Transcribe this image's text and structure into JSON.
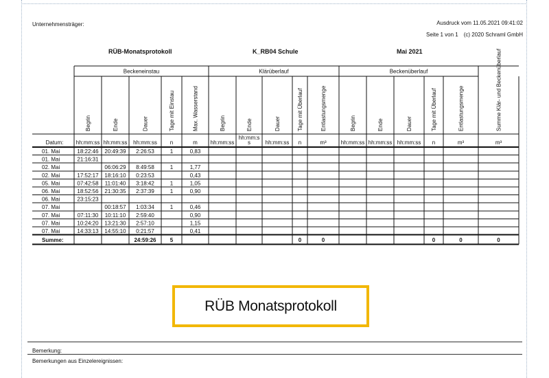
{
  "header": {
    "company_label": "Unternehmensträger:",
    "printout": "Ausdruck vom 11.05.2021 09:41:02",
    "page": "Seite 1 von 1",
    "copyright": "(c) 2020 Schraml GmbH"
  },
  "titles": {
    "report": "RÜB-Monatsprotokoll",
    "station": "K_RB04 Schule",
    "period": "Mai 2021"
  },
  "groups": [
    "Beckeneinstau",
    "Klärüberlauf",
    "Beckenüberlauf"
  ],
  "columns": [
    {
      "header": "Begrin",
      "unit": "hh:mm:ss"
    },
    {
      "header": "Ende",
      "unit": "hh:mm:ss"
    },
    {
      "header": "Dauer",
      "unit": "hh:mm:ss"
    },
    {
      "header": "Tage mit Einstau",
      "unit": "n"
    },
    {
      "header": "Max. Wasserstand",
      "unit": "m"
    },
    {
      "header": "Begrin",
      "unit": "hh:mm:ss"
    },
    {
      "header": "Ende",
      "unit": "hh:mm:s s"
    },
    {
      "header": "Dauer",
      "unit": "hh:mm:ss"
    },
    {
      "header": "Tage mit Überlauf",
      "unit": "n"
    },
    {
      "header": "Entlastungsmenge",
      "unit": "m³"
    },
    {
      "header": "Begrin",
      "unit": "hh:mm:ss"
    },
    {
      "header": "Ende",
      "unit": "hh:mm:ss"
    },
    {
      "header": "Dauer",
      "unit": "hh:mm:ss"
    },
    {
      "header": "Tage mit Überlauf",
      "unit": "n"
    },
    {
      "header": "Entlastungsmenge",
      "unit": "m³"
    },
    {
      "header": "Summe Klär- und Beckenüberlauf",
      "unit": "m³"
    }
  ],
  "date_label": "Datum:",
  "rows": [
    {
      "date": "01. Mai",
      "cells": [
        "18:22:46",
        "20:49:39",
        "2:26:53",
        "1",
        "0,83"
      ]
    },
    {
      "date": "01. Mai",
      "cells": [
        "21:16:31",
        "",
        "",
        "",
        ""
      ]
    },
    {
      "date": "02. Mai",
      "cells": [
        "",
        "06:06:29",
        "8:49:58",
        "1",
        "1,77"
      ]
    },
    {
      "date": "02. Mai",
      "cells": [
        "17:52:17",
        "18:16:10",
        "0:23:53",
        "",
        "0,43"
      ]
    },
    {
      "date": "05. Mai",
      "cells": [
        "07:42:58",
        "11:01:40",
        "3:18:42",
        "1",
        "1,05"
      ]
    },
    {
      "date": "06. Mai",
      "cells": [
        "18:52:56",
        "21:30:35",
        "2:37:39",
        "1",
        "0,90"
      ]
    },
    {
      "date": "06. Mai",
      "cells": [
        "23:15:23",
        "",
        "",
        "",
        ""
      ]
    },
    {
      "date": "07. Mai",
      "cells": [
        "",
        "00:18:57",
        "1:03:34",
        "1",
        "0,46"
      ]
    },
    {
      "date": "07. Mai",
      "cells": [
        "07:11:30",
        "10:11:10",
        "2:59:40",
        "",
        "0,90"
      ]
    },
    {
      "date": "07. Mai",
      "cells": [
        "10:24:20",
        "13:21:30",
        "2:57:10",
        "",
        "1,15"
      ]
    },
    {
      "date": "07. Mai",
      "cells": [
        "14:33:13",
        "14:55:10",
        "0:21:57",
        "",
        "0,41"
      ]
    }
  ],
  "summary": {
    "label": "Summe:",
    "values": [
      "",
      "",
      "24:59:26",
      "5",
      "",
      "",
      "",
      "",
      "0",
      "0",
      "",
      "",
      "",
      "0",
      "0",
      "0"
    ]
  },
  "banner": "RÜB Monatsprotokoll",
  "footer": {
    "remark": "Bemerkung:",
    "remark_events": "Bemerkungen aus Einzelereignissen:"
  }
}
